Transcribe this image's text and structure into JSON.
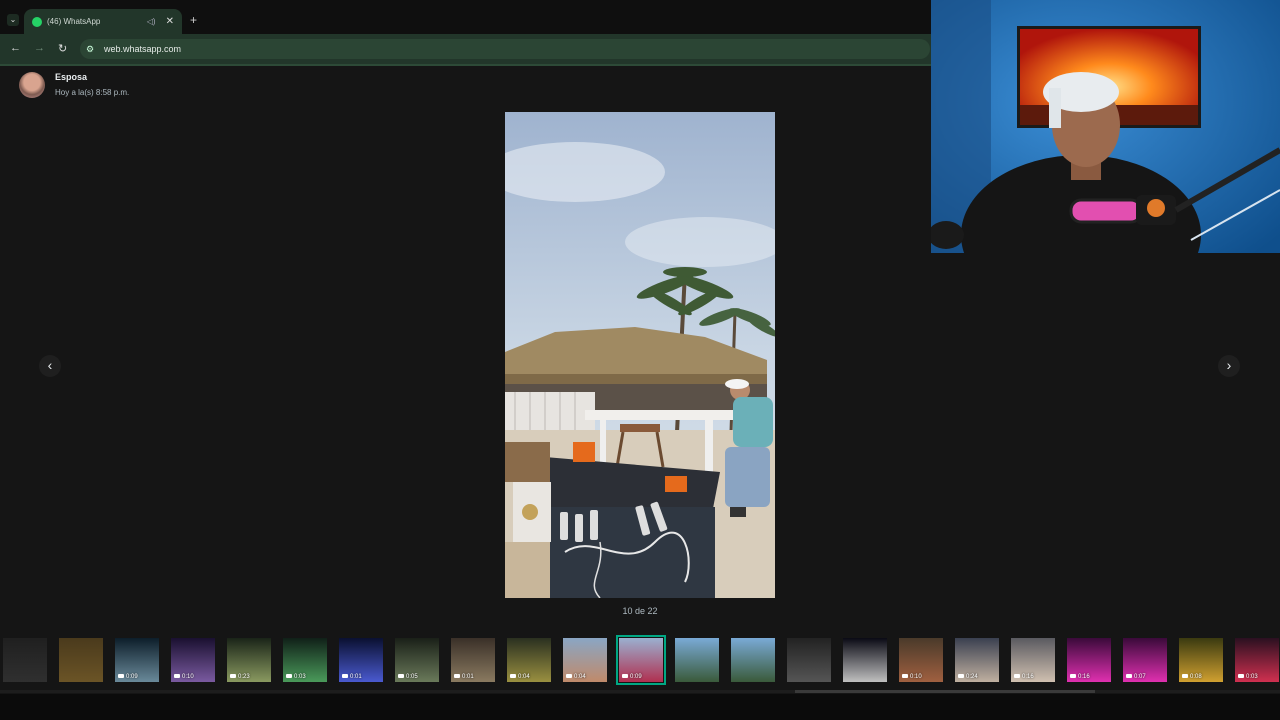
{
  "browser": {
    "tab_title": "(46) WhatsApp",
    "tab_audio_icon": "speaker-icon",
    "tab_close": "✕",
    "new_tab": "+",
    "url": "web.whatsapp.com"
  },
  "viewer": {
    "contact_name": "Esposa",
    "timestamp": "Hoy a la(s) 8:58 p.m.",
    "counter": "10 de 22",
    "prev_label": "‹",
    "next_label": "›"
  },
  "thumbnails": [
    {
      "duration": "",
      "scene": "dark-blur"
    },
    {
      "duration": "",
      "scene": "brown"
    },
    {
      "duration": "0:09",
      "scene": "night-party"
    },
    {
      "duration": "0:10",
      "scene": "night-purple"
    },
    {
      "duration": "0:23",
      "scene": "night-lights"
    },
    {
      "duration": "0:03",
      "scene": "night-green"
    },
    {
      "duration": "0:01",
      "scene": "night-blue"
    },
    {
      "duration": "0:05",
      "scene": "night-trees"
    },
    {
      "duration": "0:01",
      "scene": "dusk"
    },
    {
      "duration": "0:04",
      "scene": "dusk-green"
    },
    {
      "duration": "0:04",
      "scene": "beach-day"
    },
    {
      "duration": "0:09",
      "scene": "beach-selected",
      "selected": true
    },
    {
      "duration": "",
      "scene": "palms-sky"
    },
    {
      "duration": "",
      "scene": "palms-sky"
    },
    {
      "duration": "",
      "scene": "palms-dark"
    },
    {
      "duration": "",
      "scene": "palms-night"
    },
    {
      "duration": "0:10",
      "scene": "shop"
    },
    {
      "duration": "0:24",
      "scene": "room"
    },
    {
      "duration": "0:16",
      "scene": "room-light"
    },
    {
      "duration": "0:16",
      "scene": "pink"
    },
    {
      "duration": "0:07",
      "scene": "pink"
    },
    {
      "duration": "0:08",
      "scene": "yellow"
    },
    {
      "duration": "0:03",
      "scene": "red-dark"
    }
  ],
  "colors": {
    "accent": "#00a884",
    "chrome_green": "#22362a",
    "background": "#151515"
  }
}
